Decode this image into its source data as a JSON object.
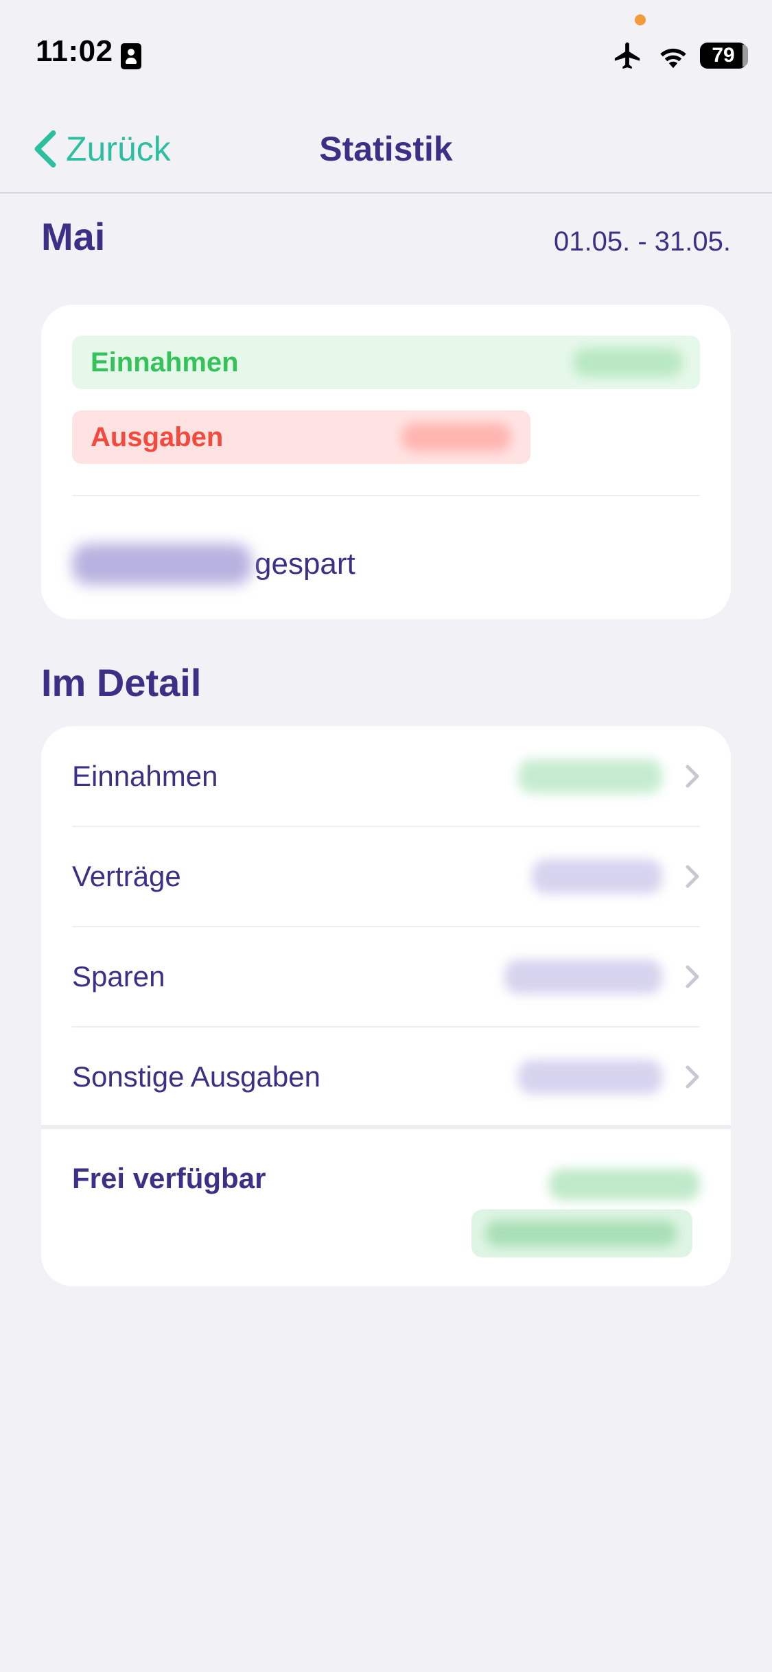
{
  "status_bar": {
    "time": "11:02",
    "battery": "79",
    "icons": [
      "person-card-icon",
      "airplane-icon",
      "wifi-icon",
      "battery-icon"
    ],
    "indicator_color": "#f39a3c"
  },
  "nav": {
    "back_label": "Zurück",
    "title": "Statistik"
  },
  "period": {
    "month": "Mai",
    "range": "01.05. - 31.05."
  },
  "summary": {
    "income_label": "Einnahmen",
    "expense_label": "Ausgaben",
    "saved_suffix": "gespart"
  },
  "detail": {
    "heading": "Im Detail",
    "rows": [
      {
        "label": "Einnahmen"
      },
      {
        "label": "Verträge"
      },
      {
        "label": "Sparen"
      },
      {
        "label": "Sonstige Ausgaben"
      }
    ],
    "free_label": "Frei verfügbar"
  },
  "colors": {
    "primary": "#3d2f86",
    "accent": "#2bbfa0",
    "income": "#36c25a",
    "income_bg": "#e6f8ea",
    "expense": "#f24a3d",
    "expense_bg": "#ffe3e3",
    "background": "#f2f1f6"
  }
}
